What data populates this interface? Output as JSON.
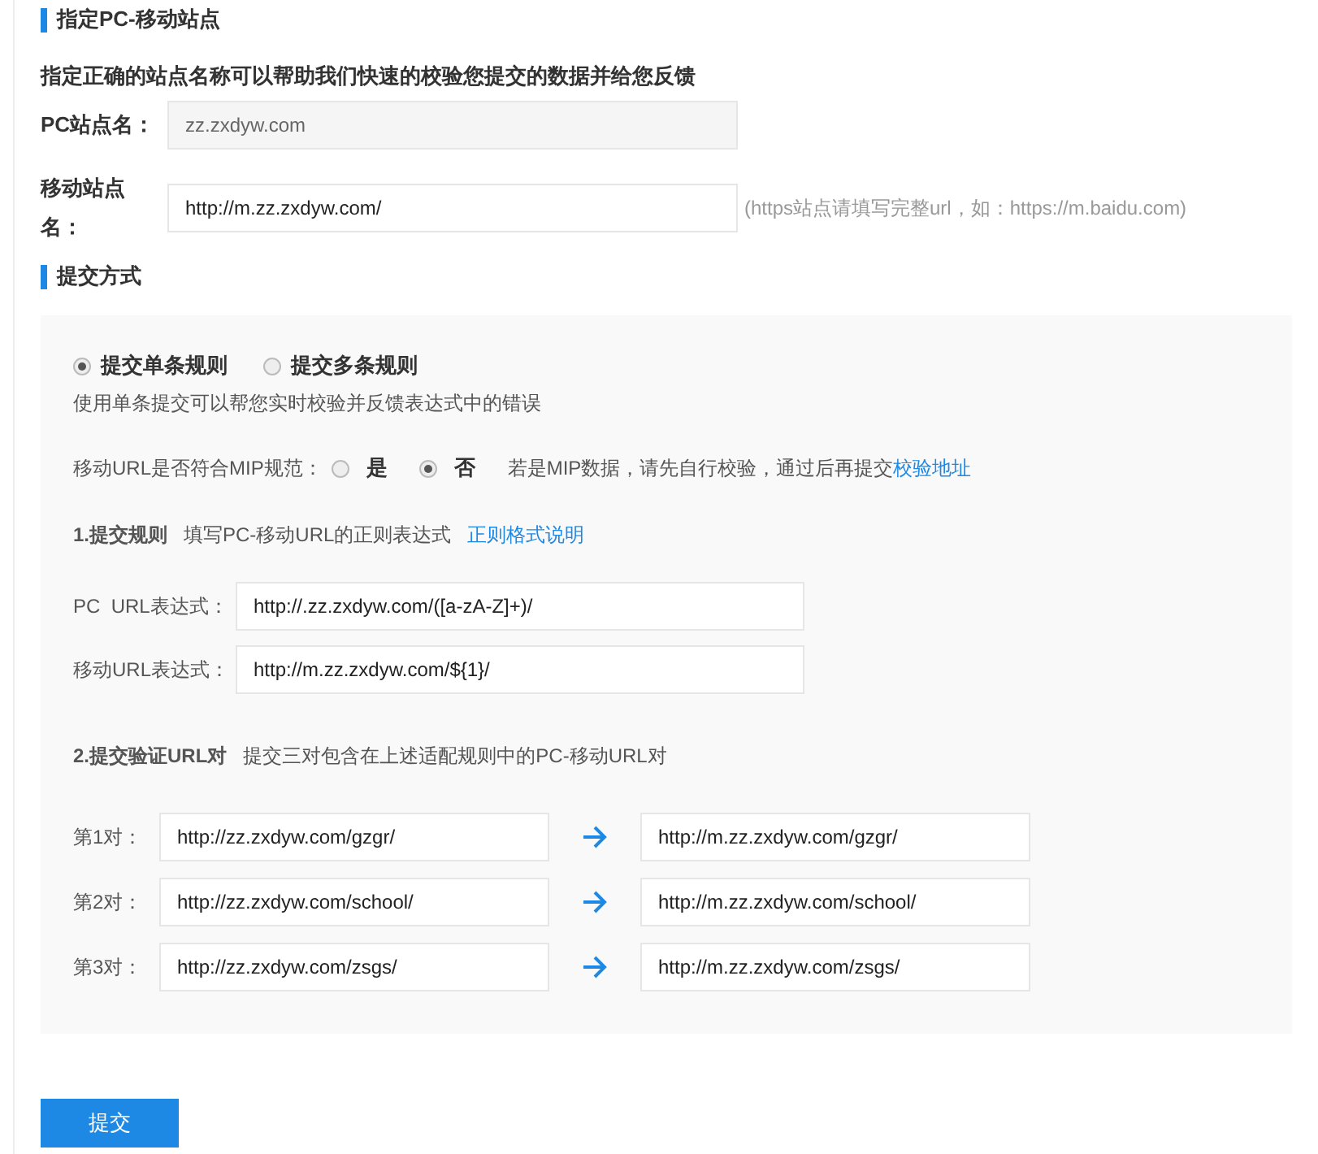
{
  "section_site": {
    "title": "指定PC-移动站点",
    "description": "指定正确的站点名称可以帮助我们快速的校验您提交的数据并给您反馈",
    "pc_site": {
      "label": "PC站点名：",
      "value": "zz.zxdyw.com",
      "disabled": true
    },
    "mobile_site": {
      "label": "移动站点名：",
      "value": "http://m.zz.zxdyw.com/",
      "disabled": false,
      "hint": "(https站点请填写完整url，如：https://m.baidu.com)"
    }
  },
  "section_submit": {
    "title": "提交方式",
    "modes": [
      {
        "label": "提交单条规则",
        "selected": true
      },
      {
        "label": "提交多条规则",
        "selected": false
      }
    ],
    "mode_description": "使用单条提交可以帮您实时校验并反馈表达式中的错误",
    "mip": {
      "label": "移动URL是否符合MIP规范：",
      "options": [
        {
          "label": "是",
          "selected": false
        },
        {
          "label": "否",
          "selected": true
        }
      ],
      "note": "若是MIP数据，请先自行校验，通过后再提交",
      "link": "校验地址"
    },
    "rule": {
      "heading": "1.提交规则",
      "description": "填写PC-移动URL的正则表达式",
      "link": "正则格式说明",
      "pc_label": "PC  URL表达式：",
      "pc_value": "http://.zz.zxdyw.com/([a-zA-Z]+)/",
      "mobile_label": "移动URL表达式：",
      "mobile_value": "http://m.zz.zxdyw.com/${1}/"
    },
    "pairs_heading": "2.提交验证URL对",
    "pairs_description": "提交三对包含在上述适配规则中的PC-移动URL对",
    "pairs": [
      {
        "label": "第1对：",
        "pc": "http://zz.zxdyw.com/gzgr/",
        "mobile": "http://m.zz.zxdyw.com/gzgr/"
      },
      {
        "label": "第2对：",
        "pc": "http://zz.zxdyw.com/school/",
        "mobile": "http://m.zz.zxdyw.com/school/"
      },
      {
        "label": "第3对：",
        "pc": "http://zz.zxdyw.com/zsgs/",
        "mobile": "http://m.zz.zxdyw.com/zsgs/"
      }
    ]
  },
  "submit_button": "提交"
}
